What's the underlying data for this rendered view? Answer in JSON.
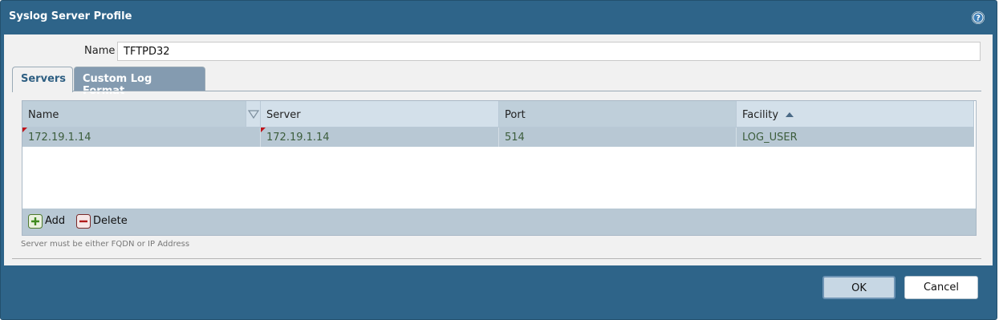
{
  "dialog": {
    "title": "Syslog Server Profile",
    "help_icon": "help-icon"
  },
  "form": {
    "name_label": "Name",
    "name_value": "TFTPD32"
  },
  "tabs": [
    {
      "label": "Servers",
      "selected": true
    },
    {
      "label": "Custom Log Format",
      "selected": false
    }
  ],
  "grid": {
    "columns": [
      {
        "label": "Name",
        "filter_icon": "filter-triangle-icon"
      },
      {
        "label": "Server"
      },
      {
        "label": "Port"
      },
      {
        "label": "Facility",
        "sort_icon": "sort-ascending-icon"
      }
    ],
    "rows": [
      {
        "name": "172.19.1.14",
        "server": "172.19.1.14",
        "port": "514",
        "facility": "LOG_USER"
      }
    ]
  },
  "toolbar": {
    "add_label": "Add",
    "delete_label": "Delete"
  },
  "note": "Server must be either FQDN or IP Address",
  "buttons": {
    "ok": "OK",
    "cancel": "Cancel"
  },
  "colors": {
    "dialog_frame": "#2e6489",
    "body_bg": "#f1f1f1",
    "selected_row": "#b8c8d4",
    "error_marker": "#c0131a"
  }
}
